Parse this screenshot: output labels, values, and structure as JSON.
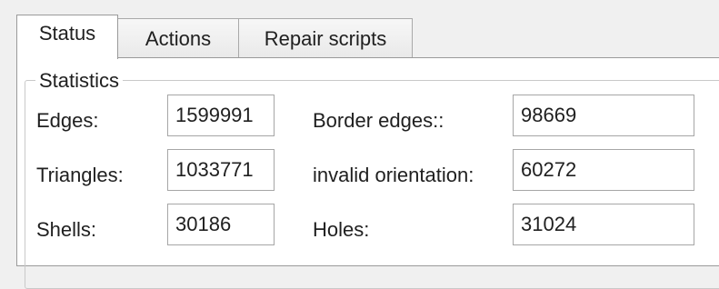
{
  "tabs": [
    {
      "label": "Status",
      "active": true
    },
    {
      "label": "Actions",
      "active": false
    },
    {
      "label": "Repair scripts",
      "active": false
    }
  ],
  "statistics": {
    "title": "Statistics",
    "edges_label": "Edges:",
    "edges_value": "1599991",
    "border_edges_label": "Border edges::",
    "border_edges_value": "98669",
    "triangles_label": "Triangles:",
    "triangles_value": "1033771",
    "invalid_orientation_label": "invalid orientation:",
    "invalid_orientation_value": "60272",
    "shells_label": "Shells:",
    "shells_value": "30186",
    "holes_label": "Holes:",
    "holes_value": "31024"
  }
}
